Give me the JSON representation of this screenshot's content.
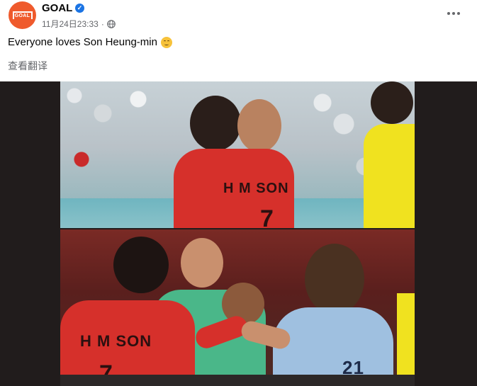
{
  "post": {
    "page_name": "GOAL",
    "avatar_text": "GOAL",
    "verified_mark": "✓",
    "timestamp": "11月24日23:33",
    "separator": "·",
    "text": "Everyone loves Son Heung-min",
    "translate_label": "查看翻译"
  },
  "media": {
    "top_photo": {
      "jersey_text": "H M SON",
      "jersey_number": "7"
    },
    "bottom_photo": {
      "jersey_text": "H M SON",
      "jersey_number": "7",
      "uruguay_number": "21"
    }
  },
  "icons": {
    "verified": "verified-badge-icon",
    "privacy": "globe-icon",
    "more": "more-options-icon",
    "emoji": "smiling-face-icon"
  },
  "colors": {
    "brand": "#ef5a2c",
    "verified": "#1b74e4",
    "secondary_text": "#65676b",
    "media_background": "#211c1c"
  }
}
